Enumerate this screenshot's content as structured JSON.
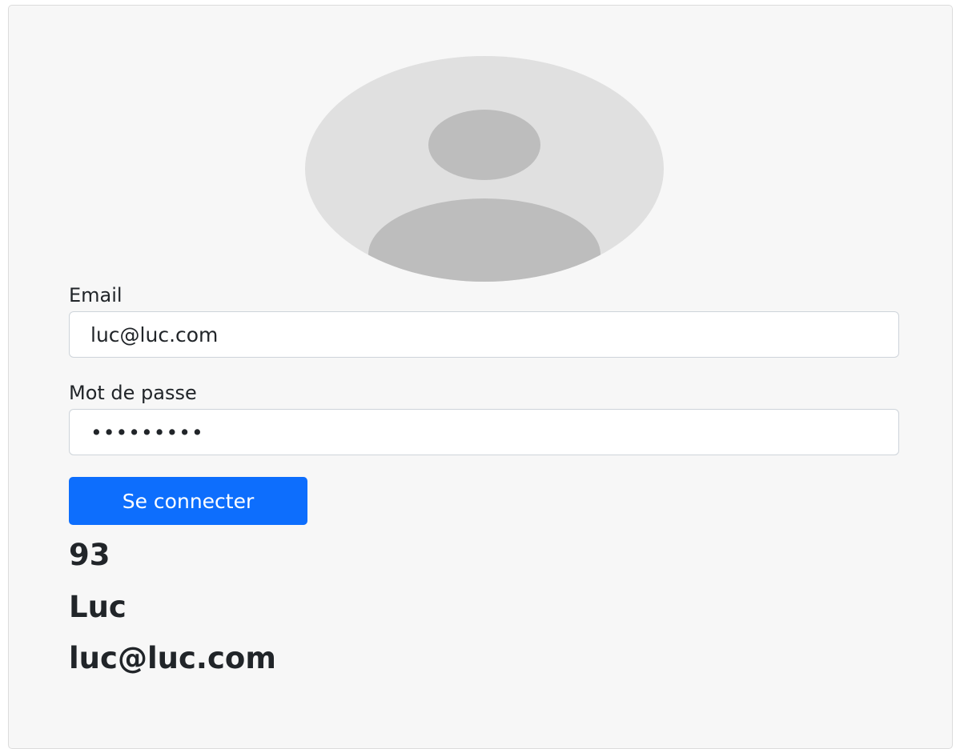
{
  "form": {
    "avatar_icon": "user-avatar-placeholder",
    "email_label": "Email",
    "email_value": "luc@luc.com",
    "password_label": "Mot de passe",
    "password_value": "•••••••••",
    "submit_label": "Se connecter"
  },
  "user": {
    "id": "93",
    "name": "Luc",
    "email": "luc@luc.com"
  },
  "colors": {
    "primary_button": "#0d6efd",
    "card_background": "#f7f7f7",
    "avatar_background": "#e0e0e0",
    "avatar_figure": "#bdbdbd"
  }
}
